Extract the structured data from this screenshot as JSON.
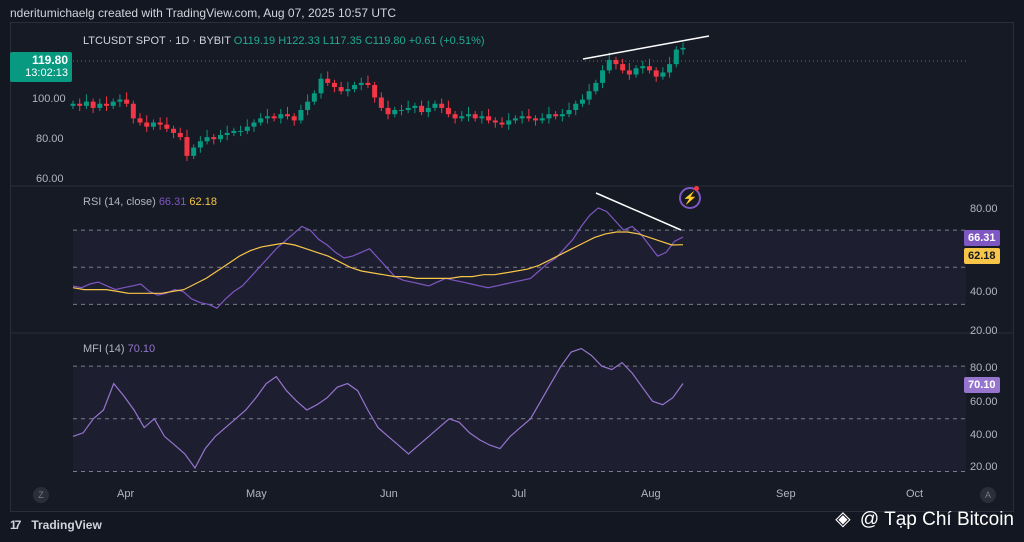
{
  "header": {
    "credit": "nderitumichaelg created with TradingView.com, Aug 07, 2025 10:57 UTC"
  },
  "symbol": {
    "name": "LTCUSDT SPOT · 1D · BYBIT",
    "ohlc": "O119.19 H122.33 L117.35 C119.80 +0.61 (+0.51%)",
    "last_price": "119.80",
    "countdown": "13:02:13"
  },
  "price_axis": {
    "ticks": [
      "100.00",
      "80.00",
      "60.00"
    ]
  },
  "rsi": {
    "label": "RSI (14, close)",
    "value": "66.31",
    "ma": "62.18",
    "ticks": [
      "80.00",
      "40.00",
      "20.00"
    ]
  },
  "mfi": {
    "label": "MFI (14)",
    "value": "70.10",
    "ticks": [
      "80.00",
      "60.00",
      "40.00",
      "20.00"
    ]
  },
  "time_axis": {
    "months": [
      "Apr",
      "May",
      "Jun",
      "Jul",
      "Aug",
      "Sep",
      "Oct"
    ],
    "left_btn": "Z",
    "right_btn": "A"
  },
  "brand": {
    "tradingview": "TradingView",
    "watermark": "@ Tạp Chí Bitcoin"
  },
  "colors": {
    "up": "#089981",
    "down": "#f23645",
    "rsi": "#7e57c2",
    "rsi_ma": "#f7c548",
    "mfi": "#9575cd",
    "background": "#131722"
  },
  "chart_data": {
    "type": "candlestick",
    "x_axis": [
      "Apr",
      "May",
      "Jun",
      "Jul",
      "Aug",
      "Sep",
      "Oct"
    ],
    "price_ylim": [
      55,
      125
    ],
    "close": [
      93,
      92,
      94,
      91,
      93,
      92,
      94,
      95,
      93,
      86,
      84,
      82,
      84,
      83,
      81,
      79,
      77,
      68,
      72,
      75,
      77,
      76,
      78,
      79,
      80,
      80,
      82,
      84,
      86,
      87,
      86,
      88,
      87,
      85,
      90,
      94,
      98,
      105,
      103,
      101,
      99,
      100,
      102,
      103,
      102,
      96,
      91,
      88,
      90,
      90,
      91,
      92,
      89,
      91,
      93,
      91,
      88,
      86,
      87,
      88,
      86,
      87,
      85,
      84,
      83,
      85,
      86,
      87,
      86,
      85,
      86,
      88,
      87,
      88,
      90,
      93,
      95,
      99,
      103,
      109,
      114,
      112,
      109,
      107,
      110,
      111,
      109,
      106,
      108,
      112,
      119,
      119.8
    ],
    "rsi_ylim": [
      20,
      90
    ],
    "rsi": [
      40,
      39,
      41,
      42,
      40,
      38,
      39,
      40,
      41,
      37,
      35,
      36,
      38,
      37,
      33,
      31,
      30,
      28,
      33,
      37,
      40,
      45,
      50,
      55,
      60,
      64,
      68,
      72,
      70,
      65,
      62,
      58,
      55,
      56,
      58,
      60,
      55,
      50,
      45,
      43,
      42,
      41,
      40,
      42,
      44,
      43,
      42,
      41,
      40,
      39,
      40,
      41,
      42,
      43,
      44,
      48,
      52,
      55,
      60,
      65,
      72,
      78,
      82,
      80,
      75,
      70,
      72,
      68,
      62,
      56,
      58,
      64,
      66.31
    ],
    "rsi_ma": [
      39,
      38,
      38,
      38,
      37,
      36,
      36,
      36,
      36,
      37,
      38,
      41,
      44,
      48,
      52,
      56,
      59,
      61,
      62,
      63,
      62,
      60,
      58,
      56,
      53,
      50,
      48,
      47,
      46,
      45,
      45,
      44,
      44,
      44,
      44,
      45,
      45,
      46,
      46,
      47,
      48,
      49,
      51,
      54,
      57,
      60,
      63,
      66,
      68,
      69,
      69,
      68,
      66,
      64,
      62,
      62.18
    ],
    "mfi_ylim": [
      18,
      92
    ],
    "mfi": [
      40,
      42,
      50,
      55,
      70,
      63,
      55,
      45,
      50,
      40,
      35,
      30,
      22,
      33,
      40,
      45,
      50,
      55,
      62,
      70,
      74,
      66,
      60,
      55,
      58,
      62,
      68,
      70,
      66,
      55,
      45,
      40,
      35,
      30,
      35,
      40,
      45,
      50,
      48,
      42,
      38,
      35,
      33,
      40,
      45,
      50,
      60,
      70,
      80,
      88,
      90,
      86,
      80,
      78,
      82,
      76,
      68,
      60,
      58,
      62,
      70.1
    ]
  }
}
